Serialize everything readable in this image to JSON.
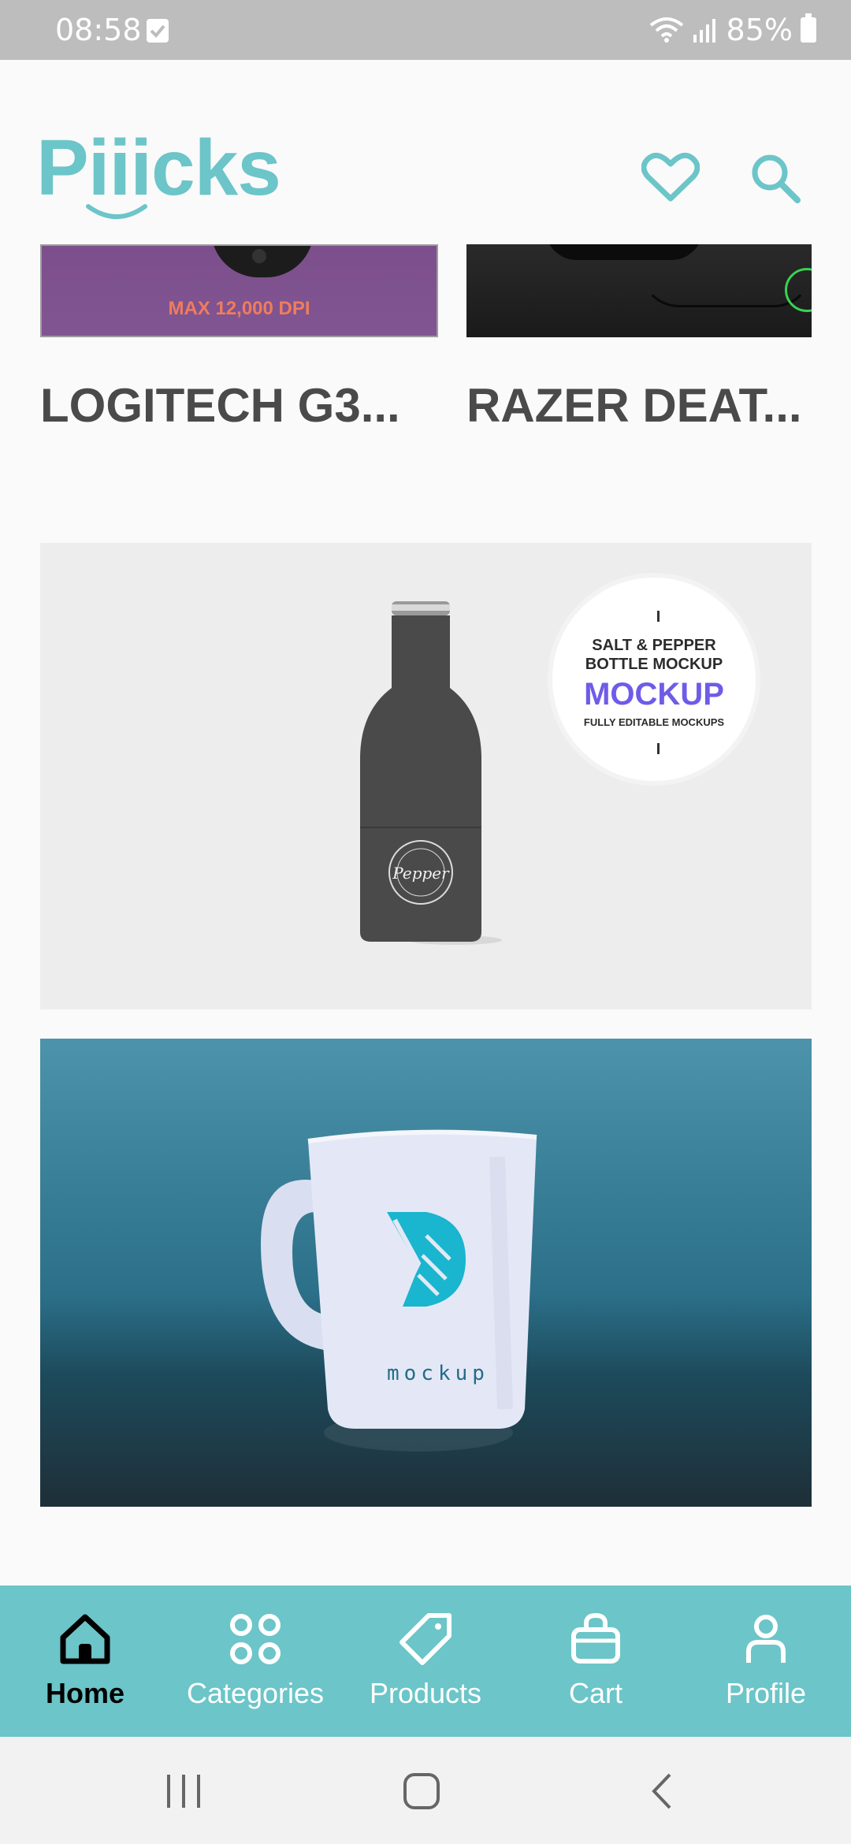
{
  "status_bar": {
    "time": "08:58",
    "battery": "85%"
  },
  "header": {
    "logo": "Piiicks",
    "favorites_icon": "heart-icon",
    "search_icon": "search-icon"
  },
  "products": [
    {
      "title": "LOGITECH G3...",
      "thumb_text": "MAX 12,000 DPI"
    },
    {
      "title": "RAZER DEAT..."
    }
  ],
  "banners": {
    "salt_pepper": {
      "line1": "SALT & PEPPER",
      "line2": "BOTTLE MOCKUP",
      "big": "MOCKUP",
      "small": "FULLY EDITABLE MOCKUPS"
    },
    "mug": {
      "text": "mockup"
    }
  },
  "bottom_nav": [
    {
      "label": "Home",
      "icon": "home-icon",
      "active": true
    },
    {
      "label": "Categories",
      "icon": "categories-icon",
      "active": false
    },
    {
      "label": "Products",
      "icon": "tag-icon",
      "active": false
    },
    {
      "label": "Cart",
      "icon": "bag-icon",
      "active": false
    },
    {
      "label": "Profile",
      "icon": "person-icon",
      "active": false
    }
  ],
  "colors": {
    "accent": "#6cc5c8",
    "status_bar": "#bdbdbd",
    "title_text": "#4a4a4a",
    "active_nav": "#000000"
  }
}
